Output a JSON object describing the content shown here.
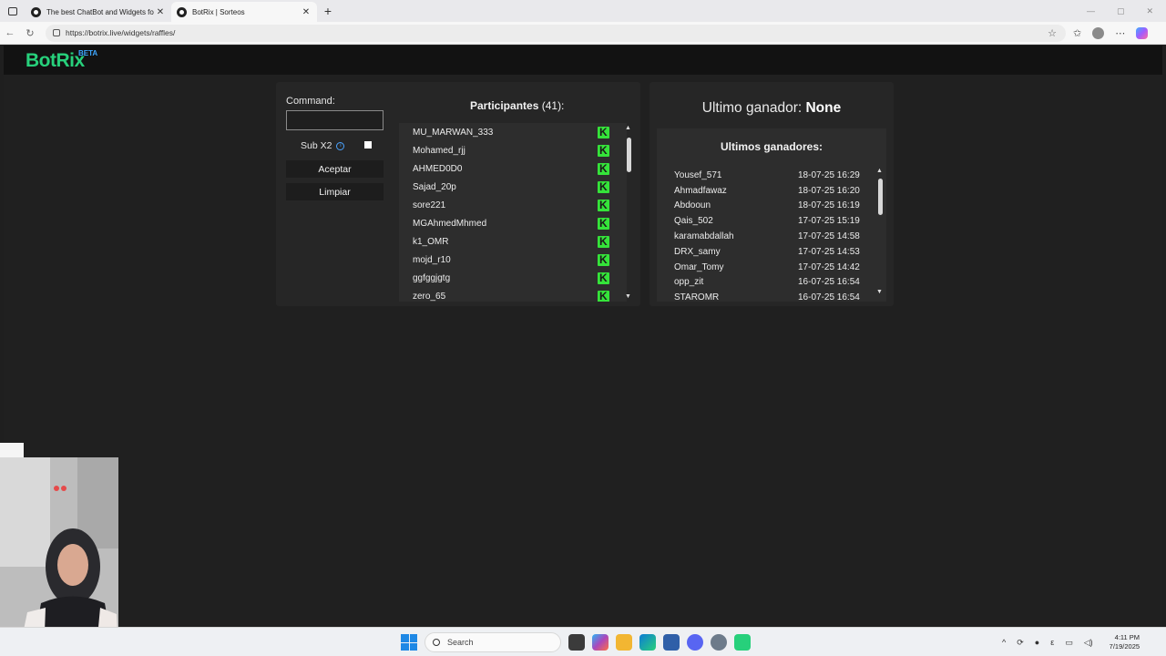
{
  "browser": {
    "tabs": [
      {
        "title": "The best ChatBot and Widgets fo",
        "active": false
      },
      {
        "title": "BotRix | Sorteos",
        "active": true
      }
    ],
    "url": "https://botrix.live/widgets/raffles/"
  },
  "app": {
    "logo": "BotRix",
    "logo_badge": "BETA",
    "accent_color": "#27d07b"
  },
  "raffle": {
    "command_label": "Command:",
    "command_value": "",
    "sub_label": "Sub X2",
    "sub_checked": false,
    "accept_label": "Aceptar",
    "clear_label": "Limpiar",
    "participants_title": "Participantes",
    "participants_count": "(41):",
    "participants": [
      "MU_MARWAN_333",
      "Mohamed_rjj",
      "AHMED0D0",
      "Sajad_20p",
      "sore221",
      "MGAhmedMhmed",
      "k1_OMR",
      "mojd_r10",
      "ggfggjgtg",
      "zero_65"
    ],
    "platform_icon": "kick-icon"
  },
  "winners": {
    "last_label": "Ultimo ganador:",
    "last_value": "None",
    "list_title": "Ultimos ganadores:",
    "rows": [
      {
        "name": "Yousef_571",
        "date": "18-07-25 16:29"
      },
      {
        "name": "Ahmadfawaz",
        "date": "18-07-25 16:20"
      },
      {
        "name": "Abdooun",
        "date": "18-07-25 16:19"
      },
      {
        "name": "Qais_502",
        "date": "17-07-25 15:19"
      },
      {
        "name": "karamabdallah",
        "date": "17-07-25 14:58"
      },
      {
        "name": "DRX_samy",
        "date": "17-07-25 14:53"
      },
      {
        "name": "Omar_Tomy",
        "date": "17-07-25 14:42"
      },
      {
        "name": "opp_zit",
        "date": "16-07-25 16:54"
      },
      {
        "name": "STAROMR",
        "date": "16-07-25 16:54"
      }
    ]
  },
  "taskbar": {
    "search_placeholder": "Search",
    "time": "4:11 PM",
    "date": "7/19/2025"
  }
}
